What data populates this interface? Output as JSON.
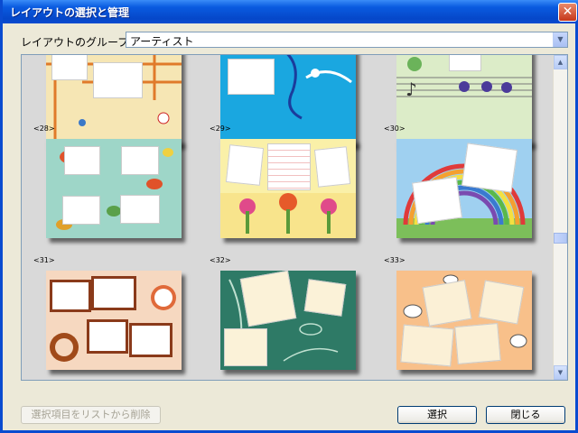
{
  "window": {
    "title": "レイアウトの選択と管理",
    "close_glyph": "✕"
  },
  "group": {
    "label": "レイアウトのグループ名",
    "selected": "アーティスト",
    "arrow": "▼"
  },
  "scrollbar": {
    "up": "▲",
    "down": "▼"
  },
  "layouts": [
    {
      "label": "<28>"
    },
    {
      "label": "<29>"
    },
    {
      "label": "<30>"
    },
    {
      "label": "<31>"
    },
    {
      "label": "<32>"
    },
    {
      "label": "<33>"
    }
  ],
  "buttons": {
    "remove": "選択項目をリストから削除",
    "select": "選択",
    "close": "閉じる"
  }
}
